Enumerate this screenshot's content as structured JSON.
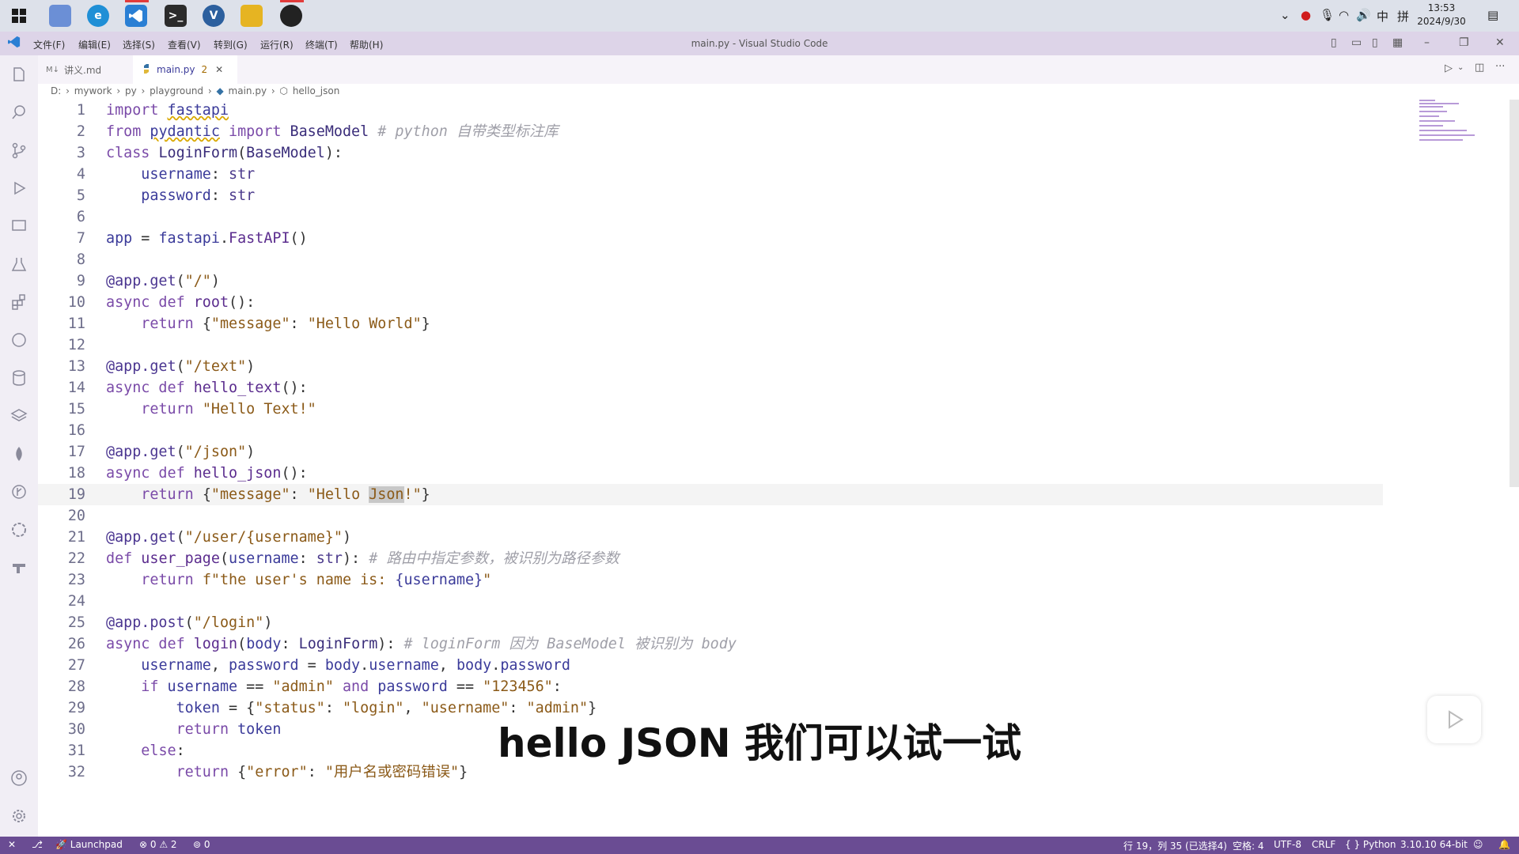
{
  "taskbar": {
    "icons": [
      "windows-start-icon",
      "file-manager-icon",
      "edge-icon",
      "vscode-icon",
      "terminal-icon",
      "vetur-icon",
      "folder-icon",
      "app-icon"
    ],
    "tray": {
      "ime_label": "中",
      "grid_label": "拼"
    },
    "clock": {
      "time": "13:53",
      "date": "2024/9/30"
    }
  },
  "menubar": {
    "items": [
      "文件(F)",
      "编辑(E)",
      "选择(S)",
      "查看(V)",
      "转到(G)",
      "运行(R)",
      "终端(T)",
      "帮助(H)"
    ],
    "window_title": "main.py - Visual Studio Code"
  },
  "tabs": [
    {
      "label": "讲义.md",
      "icon": "markdown-icon"
    },
    {
      "label": "main.py",
      "badge": "2",
      "icon": "python-icon",
      "active": true
    }
  ],
  "breadcrumbs": [
    "D:",
    "mywork",
    "py",
    "playground",
    "main.py",
    "hello_json"
  ],
  "editor": {
    "lines": [
      {
        "n": "1",
        "tokens": [
          [
            "kw",
            "import "
          ],
          [
            "var",
            "fastapi"
          ]
        ]
      },
      {
        "n": "2",
        "tokens": [
          [
            "kw",
            "from "
          ],
          [
            "var",
            "pydantic"
          ],
          [
            "kw",
            " import "
          ],
          [
            "cls",
            "BaseModel"
          ],
          [
            "cm",
            " # python 自带类型标注库"
          ]
        ]
      },
      {
        "n": "3",
        "tokens": [
          [
            "kw",
            "class "
          ],
          [
            "cls",
            "LoginForm"
          ],
          [
            "op",
            "("
          ],
          [
            "cls",
            "BaseModel"
          ],
          [
            "op",
            "):"
          ]
        ]
      },
      {
        "n": "4",
        "tokens": [
          [
            "op",
            "    "
          ],
          [
            "var",
            "username"
          ],
          [
            "op",
            ": "
          ],
          [
            "kw2",
            "str"
          ]
        ]
      },
      {
        "n": "5",
        "tokens": [
          [
            "op",
            "    "
          ],
          [
            "var",
            "password"
          ],
          [
            "op",
            ": "
          ],
          [
            "kw2",
            "str"
          ]
        ]
      },
      {
        "n": "6",
        "tokens": []
      },
      {
        "n": "7",
        "tokens": [
          [
            "var",
            "app"
          ],
          [
            "op",
            " = "
          ],
          [
            "var",
            "fastapi"
          ],
          [
            "op",
            "."
          ],
          [
            "fn",
            "FastAPI"
          ],
          [
            "op",
            "()"
          ]
        ]
      },
      {
        "n": "8",
        "tokens": []
      },
      {
        "n": "9",
        "tokens": [
          [
            "dec",
            "@app.get"
          ],
          [
            "op",
            "("
          ],
          [
            "str",
            "\"/\""
          ],
          [
            "op",
            ")"
          ]
        ]
      },
      {
        "n": "10",
        "tokens": [
          [
            "kw",
            "async def "
          ],
          [
            "fn",
            "root"
          ],
          [
            "op",
            "():"
          ]
        ]
      },
      {
        "n": "11",
        "tokens": [
          [
            "op",
            "    "
          ],
          [
            "kw",
            "return "
          ],
          [
            "op",
            "{"
          ],
          [
            "str",
            "\"message\""
          ],
          [
            "op",
            ": "
          ],
          [
            "str",
            "\"Hello World\""
          ],
          [
            "op",
            "}"
          ]
        ]
      },
      {
        "n": "12",
        "tokens": []
      },
      {
        "n": "13",
        "tokens": [
          [
            "dec",
            "@app.get"
          ],
          [
            "op",
            "("
          ],
          [
            "str",
            "\"/text\""
          ],
          [
            "op",
            ")"
          ]
        ]
      },
      {
        "n": "14",
        "tokens": [
          [
            "kw",
            "async def "
          ],
          [
            "fn",
            "hello_text"
          ],
          [
            "op",
            "():"
          ]
        ]
      },
      {
        "n": "15",
        "tokens": [
          [
            "op",
            "    "
          ],
          [
            "kw",
            "return "
          ],
          [
            "str",
            "\"Hello Text!\""
          ]
        ]
      },
      {
        "n": "16",
        "tokens": []
      },
      {
        "n": "17",
        "tokens": [
          [
            "dec",
            "@app.get"
          ],
          [
            "op",
            "("
          ],
          [
            "str",
            "\"/json\""
          ],
          [
            "op",
            ")"
          ]
        ]
      },
      {
        "n": "18",
        "tokens": [
          [
            "kw",
            "async def "
          ],
          [
            "fn",
            "hello_json"
          ],
          [
            "op",
            "():"
          ]
        ]
      },
      {
        "n": "19",
        "tokens": [
          [
            "op",
            "    "
          ],
          [
            "kw",
            "return "
          ],
          [
            "op",
            "{"
          ],
          [
            "str",
            "\"message\""
          ],
          [
            "op",
            ": "
          ],
          [
            "str",
            "\"Hello "
          ],
          [
            "hl",
            "Json"
          ],
          [
            "str",
            "!\""
          ],
          [
            "op",
            "}"
          ]
        ]
      },
      {
        "n": "20",
        "tokens": []
      },
      {
        "n": "21",
        "tokens": [
          [
            "dec",
            "@app.get"
          ],
          [
            "op",
            "("
          ],
          [
            "str",
            "\"/user/{username}\""
          ],
          [
            "op",
            ")"
          ]
        ]
      },
      {
        "n": "22",
        "tokens": [
          [
            "kw",
            "def "
          ],
          [
            "fn",
            "user_page"
          ],
          [
            "op",
            "("
          ],
          [
            "var",
            "username"
          ],
          [
            "op",
            ": "
          ],
          [
            "kw2",
            "str"
          ],
          [
            "op",
            "):"
          ],
          [
            "cm",
            " # 路由中指定参数，被识别为路径参数"
          ]
        ]
      },
      {
        "n": "23",
        "tokens": [
          [
            "op",
            "    "
          ],
          [
            "kw",
            "return "
          ],
          [
            "str",
            "f\"the user's name is: "
          ],
          [
            "var",
            "{username}"
          ],
          [
            "str",
            "\""
          ]
        ]
      },
      {
        "n": "24",
        "tokens": []
      },
      {
        "n": "25",
        "tokens": [
          [
            "dec",
            "@app.post"
          ],
          [
            "op",
            "("
          ],
          [
            "str",
            "\"/login\""
          ],
          [
            "op",
            ")"
          ]
        ]
      },
      {
        "n": "26",
        "tokens": [
          [
            "kw",
            "async def "
          ],
          [
            "fn",
            "login"
          ],
          [
            "op",
            "("
          ],
          [
            "var",
            "body"
          ],
          [
            "op",
            ": "
          ],
          [
            "cls",
            "LoginForm"
          ],
          [
            "op",
            "):"
          ],
          [
            "cm",
            " # loginForm 因为 BaseModel 被识别为 body"
          ]
        ]
      },
      {
        "n": "27",
        "tokens": [
          [
            "op",
            "    "
          ],
          [
            "var",
            "username"
          ],
          [
            "op",
            ", "
          ],
          [
            "var",
            "password"
          ],
          [
            "op",
            " = "
          ],
          [
            "var",
            "body"
          ],
          [
            "op",
            "."
          ],
          [
            "var",
            "username"
          ],
          [
            "op",
            ", "
          ],
          [
            "var",
            "body"
          ],
          [
            "op",
            "."
          ],
          [
            "var",
            "password"
          ]
        ]
      },
      {
        "n": "28",
        "tokens": [
          [
            "op",
            "    "
          ],
          [
            "kw",
            "if "
          ],
          [
            "var",
            "username"
          ],
          [
            "op",
            " == "
          ],
          [
            "str",
            "\"admin\""
          ],
          [
            "kw",
            " and "
          ],
          [
            "var",
            "password"
          ],
          [
            "op",
            " == "
          ],
          [
            "str",
            "\"123456\""
          ],
          [
            "op",
            ":"
          ]
        ]
      },
      {
        "n": "29",
        "tokens": [
          [
            "op",
            "        "
          ],
          [
            "var",
            "token"
          ],
          [
            "op",
            " = {"
          ],
          [
            "str",
            "\"status\""
          ],
          [
            "op",
            ": "
          ],
          [
            "str",
            "\"login\""
          ],
          [
            "op",
            ", "
          ],
          [
            "str",
            "\"username\""
          ],
          [
            "op",
            ": "
          ],
          [
            "str",
            "\"admin\""
          ],
          [
            "op",
            "}"
          ]
        ]
      },
      {
        "n": "30",
        "tokens": [
          [
            "op",
            "        "
          ],
          [
            "kw",
            "return "
          ],
          [
            "var",
            "token"
          ]
        ]
      },
      {
        "n": "31",
        "tokens": [
          [
            "op",
            "    "
          ],
          [
            "kw",
            "else"
          ],
          [
            "op",
            ":"
          ]
        ]
      },
      {
        "n": "32",
        "tokens": [
          [
            "op",
            "        "
          ],
          [
            "kw",
            "return "
          ],
          [
            "op",
            "{"
          ],
          [
            "str",
            "\"error\""
          ],
          [
            "op",
            ": "
          ],
          [
            "str",
            "\"用户名或密码错误\""
          ],
          [
            "op",
            "}"
          ]
        ]
      }
    ]
  },
  "subtitle": "hello  JSON 我们可以试一试",
  "statusbar": {
    "left": [
      "Launchpad",
      "0",
      "2",
      "0"
    ],
    "position": "行 19，列 35 (已选择4)",
    "spaces": "空格: 4",
    "encoding": "UTF-8",
    "eol": "CRLF",
    "language": "Python",
    "interpreter": "3.10.10 64-bit"
  },
  "colors": {
    "statusbar": "#6a4c93",
    "titlebar": "#ddd4e8",
    "accent": "#7a4aa8"
  }
}
